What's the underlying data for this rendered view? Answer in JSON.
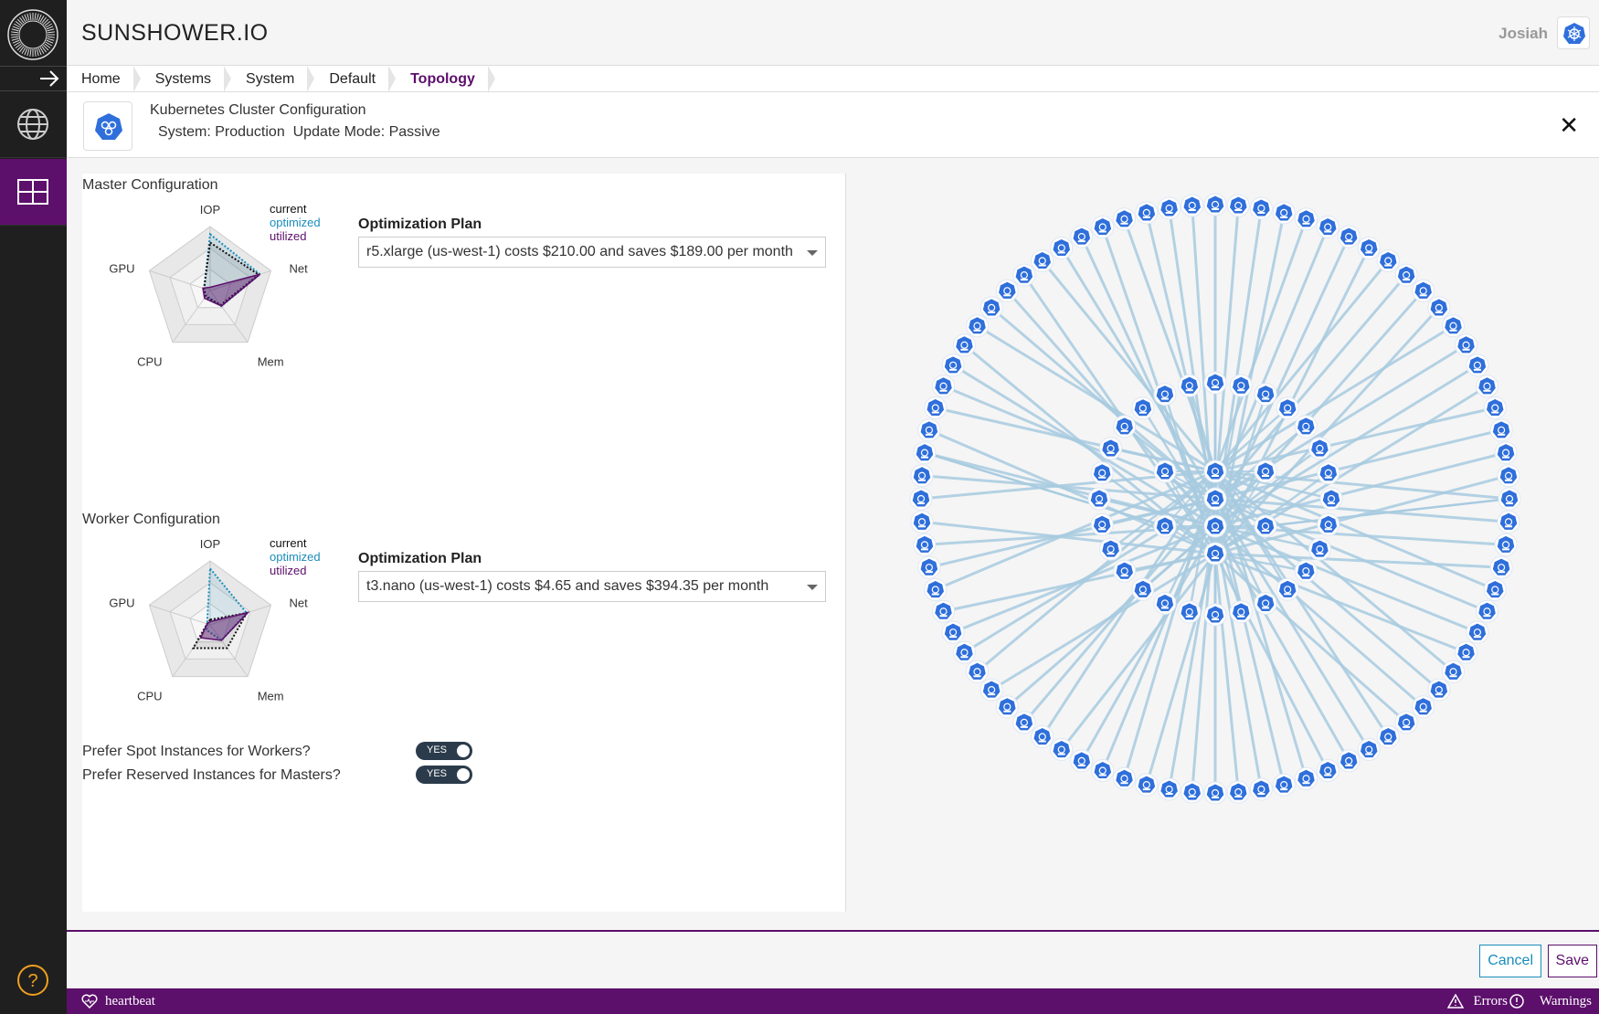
{
  "app": {
    "brand": "SUNSHOWER.IO",
    "user": "Josiah"
  },
  "colors": {
    "accent": "#5c0f6b",
    "optimized": "#1b8dbb",
    "sidebar": "#1f1f1f",
    "node": "#2f6fdb",
    "edge": "#a8cbe0"
  },
  "breadcrumb": [
    "Home",
    "Systems",
    "System",
    "Default",
    "Topology"
  ],
  "panel": {
    "title": "Kubernetes Cluster Configuration",
    "system_label": "System: Production",
    "update_mode_label": "Update Mode: Passive"
  },
  "master": {
    "title": "Master Configuration",
    "plan_label": "Optimization Plan",
    "plan_value": "r5.xlarge (us-west-1) costs $210.00 and saves $189.00 per month",
    "radar": {
      "current": [
        0.75,
        0.8,
        0.28,
        0.12,
        0.1
      ],
      "optimized": [
        0.88,
        0.82,
        0.3,
        0.1,
        0.1
      ],
      "utilized": [
        0.05,
        0.82,
        0.3,
        0.15,
        0.12
      ]
    }
  },
  "worker": {
    "title": "Worker Configuration",
    "plan_label": "Optimization Plan",
    "plan_value": "t3.nano (us-west-1) costs $4.65 and saves $394.35 per month",
    "radar": {
      "current": [
        0.08,
        0.6,
        0.45,
        0.45,
        0.05
      ],
      "optimized": [
        0.88,
        0.6,
        0.3,
        0.1,
        0.05
      ],
      "utilized": [
        0.05,
        0.62,
        0.3,
        0.25,
        0.05
      ]
    }
  },
  "legend": {
    "current": "current",
    "optimized": "optimized",
    "utilized": "utilized"
  },
  "radar_axes": [
    "IOP",
    "Net",
    "Mem",
    "CPU",
    "GPU"
  ],
  "prefs": {
    "spot_label": "Prefer Spot Instances for Workers?",
    "spot_value": "YES",
    "reserved_label": "Prefer Reserved Instances for Masters?",
    "reserved_value": "YES"
  },
  "actions": {
    "cancel": "Cancel",
    "save": "Save"
  },
  "status": {
    "heartbeat": "heartbeat",
    "errors": "Errors",
    "warnings": "Warnings"
  }
}
